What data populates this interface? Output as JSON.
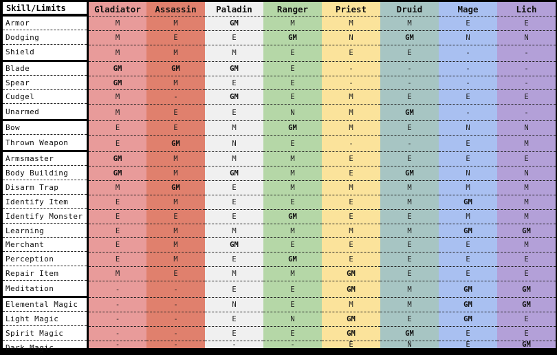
{
  "table": {
    "corner_label": "Skill/Limits",
    "columns": [
      {
        "name": "Gladiator",
        "color": "#e89b9a"
      },
      {
        "name": "Assassin",
        "color": "#e0806d"
      },
      {
        "name": "Paladin",
        "color": "#f0f0f0"
      },
      {
        "name": "Ranger",
        "color": "#b5d7a7"
      },
      {
        "name": "Priest",
        "color": "#fbe39b"
      },
      {
        "name": "Druid",
        "color": "#a7c5c3"
      },
      {
        "name": "Mage",
        "color": "#a9c0f1"
      },
      {
        "name": "Lich",
        "color": "#b3a0d8"
      }
    ],
    "groups": [
      [
        {
          "skill": "Armor",
          "values": [
            "M",
            "M",
            "GM",
            "M",
            "M",
            "M",
            "E",
            "E"
          ]
        },
        {
          "skill": "Dodging",
          "values": [
            "M",
            "E",
            "E",
            "GM",
            "N",
            "GM",
            "N",
            "N"
          ]
        },
        {
          "skill": "Shield",
          "values": [
            "M",
            "M",
            "M",
            "E",
            "E",
            "E",
            "-",
            "-"
          ]
        }
      ],
      [
        {
          "skill": "Blade",
          "values": [
            "GM",
            "GM",
            "GM",
            "E",
            "-",
            "-",
            "-",
            "-"
          ]
        },
        {
          "skill": "Spear",
          "values": [
            "GM",
            "M",
            "E",
            "E",
            "-",
            "-",
            "-",
            "-"
          ]
        },
        {
          "skill": "Cudgel",
          "values": [
            "M",
            "-",
            "GM",
            "E",
            "M",
            "E",
            "E",
            "E"
          ]
        },
        {
          "skill": "Unarmed",
          "values": [
            "M",
            "E",
            "E",
            "N",
            "M",
            "GM",
            "-",
            "-"
          ]
        }
      ],
      [
        {
          "skill": "Bow",
          "values": [
            "E",
            "E",
            "M",
            "GM",
            "M",
            "E",
            "N",
            "N"
          ]
        },
        {
          "skill": "Thrown Weapon",
          "values": [
            "E",
            "GM",
            "N",
            "E",
            "-",
            "-",
            "E",
            "M"
          ]
        }
      ],
      [
        {
          "skill": "Armsmaster",
          "values": [
            "GM",
            "M",
            "M",
            "M",
            "E",
            "E",
            "E",
            "E"
          ]
        },
        {
          "skill": "Body Building",
          "values": [
            "GM",
            "M",
            "GM",
            "M",
            "E",
            "GM",
            "N",
            "N"
          ]
        },
        {
          "skill": "Disarm Trap",
          "values": [
            "M",
            "GM",
            "E",
            "M",
            "M",
            "M",
            "M",
            "M"
          ]
        },
        {
          "skill": "Identify Item",
          "values": [
            "E",
            "M",
            "E",
            "E",
            "E",
            "M",
            "GM",
            "M"
          ]
        },
        {
          "skill": "Identify Monster",
          "values": [
            "E",
            "E",
            "E",
            "GM",
            "E",
            "E",
            "M",
            "M"
          ]
        },
        {
          "skill": "Learning",
          "values": [
            "E",
            "M",
            "M",
            "M",
            "M",
            "M",
            "GM",
            "GM"
          ]
        },
        {
          "skill": "Merchant",
          "values": [
            "E",
            "M",
            "GM",
            "E",
            "E",
            "E",
            "E",
            "M"
          ]
        },
        {
          "skill": "Perception",
          "values": [
            "E",
            "M",
            "E",
            "GM",
            "E",
            "E",
            "E",
            "E"
          ]
        },
        {
          "skill": "Repair Item",
          "values": [
            "M",
            "E",
            "M",
            "M",
            "GM",
            "E",
            "E",
            "E"
          ]
        },
        {
          "skill": "Meditation",
          "values": [
            "-",
            "-",
            "E",
            "E",
            "GM",
            "M",
            "GM",
            "GM"
          ]
        }
      ],
      [
        {
          "skill": "Elemental Magic",
          "values": [
            "-",
            "-",
            "N",
            "E",
            "M",
            "M",
            "GM",
            "GM"
          ]
        },
        {
          "skill": "Light Magic",
          "values": [
            "-",
            "-",
            "E",
            "N",
            "GM",
            "E",
            "GM",
            "E"
          ]
        },
        {
          "skill": "Spirit Magic",
          "values": [
            "-",
            "-",
            "E",
            "E",
            "GM",
            "GM",
            "E",
            "E"
          ]
        },
        {
          "skill": "Dark Magic",
          "values": [
            "-",
            "-",
            "-",
            "-",
            "E",
            "N",
            "E",
            "GM"
          ]
        }
      ]
    ]
  }
}
